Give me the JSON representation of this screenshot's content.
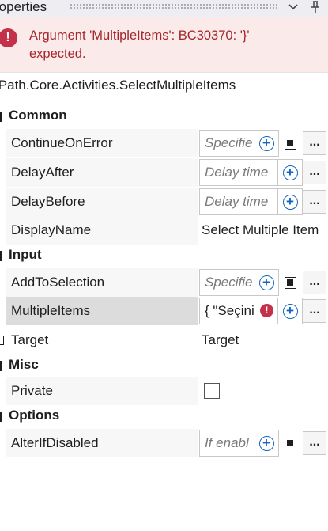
{
  "panel": {
    "title": "Properties",
    "title_visible": "roperties",
    "chevron_icon": "chevron-down-icon",
    "pin_icon": "pin-icon"
  },
  "error": {
    "message": "Argument 'MultipleItems': BC30370: '}' expected.",
    "icon": "error-icon"
  },
  "activity_type": "iPath.Core.Activities.SelectMultipleItems",
  "sections": [
    {
      "label": "Common",
      "rows": [
        {
          "name": "ContinueOnError",
          "value": "",
          "placeholder": "Specifie"
        },
        {
          "name": "DelayAfter",
          "value": "",
          "placeholder": "Delay time"
        },
        {
          "name": "DelayBefore",
          "value": "",
          "placeholder": "Delay time"
        },
        {
          "name": "DisplayName",
          "value": "Select Multiple Item",
          "placeholder": ""
        }
      ]
    },
    {
      "label": "Input",
      "rows": [
        {
          "name": "AddToSelection",
          "value": "",
          "placeholder": "Specifie"
        },
        {
          "name": "MultipleItems",
          "value": "{ \"Seçini",
          "placeholder": ""
        },
        {
          "name": "Target",
          "value": "Target",
          "placeholder": ""
        }
      ]
    },
    {
      "label": "Misc",
      "rows": [
        {
          "name": "Private",
          "value": "",
          "placeholder": ""
        }
      ]
    },
    {
      "label": "Options",
      "rows": [
        {
          "name": "AlterIfDisabled",
          "value": "",
          "placeholder": "If enabl"
        }
      ]
    }
  ],
  "ellipsis_label": "...",
  "colors": {
    "error_red": "#c4314b",
    "error_text": "#a4262c",
    "error_bg": "#fbeaea",
    "accent_blue": "#1565c0",
    "selected_row": "#dcdcdc"
  }
}
